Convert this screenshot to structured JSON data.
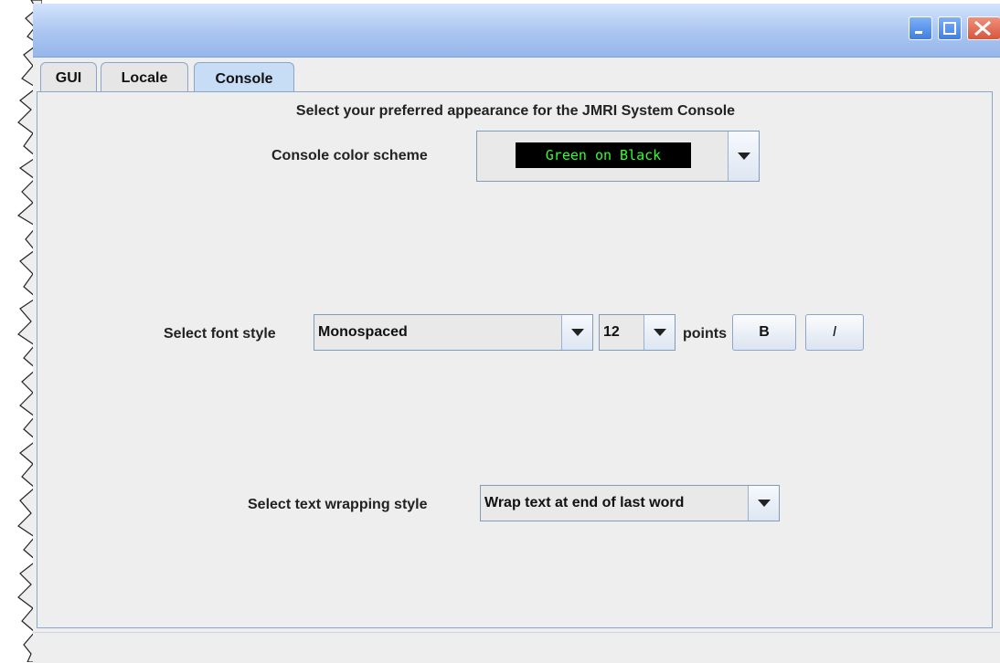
{
  "window": {
    "minimize_icon": "minimize-icon",
    "maximize_icon": "maximize-icon",
    "close_icon": "close-icon"
  },
  "tabs": [
    {
      "label": "GUI",
      "selected": false
    },
    {
      "label": "Locale",
      "selected": false
    },
    {
      "label": "Console",
      "selected": true
    }
  ],
  "console": {
    "heading": "Select your preferred appearance for the JMRI System Console",
    "color_scheme_label": "Console color scheme",
    "color_scheme_value": "Green on Black",
    "color_scheme_fg": "#33ff33",
    "color_scheme_bg": "#000000",
    "font_style_label": "Select font style",
    "font_style_value": "Monospaced",
    "font_size_value": "12",
    "points_label": "points",
    "bold_label": "B",
    "italic_label": "I",
    "wrap_label": "Select text wrapping style",
    "wrap_value": "Wrap text at end of last word"
  }
}
